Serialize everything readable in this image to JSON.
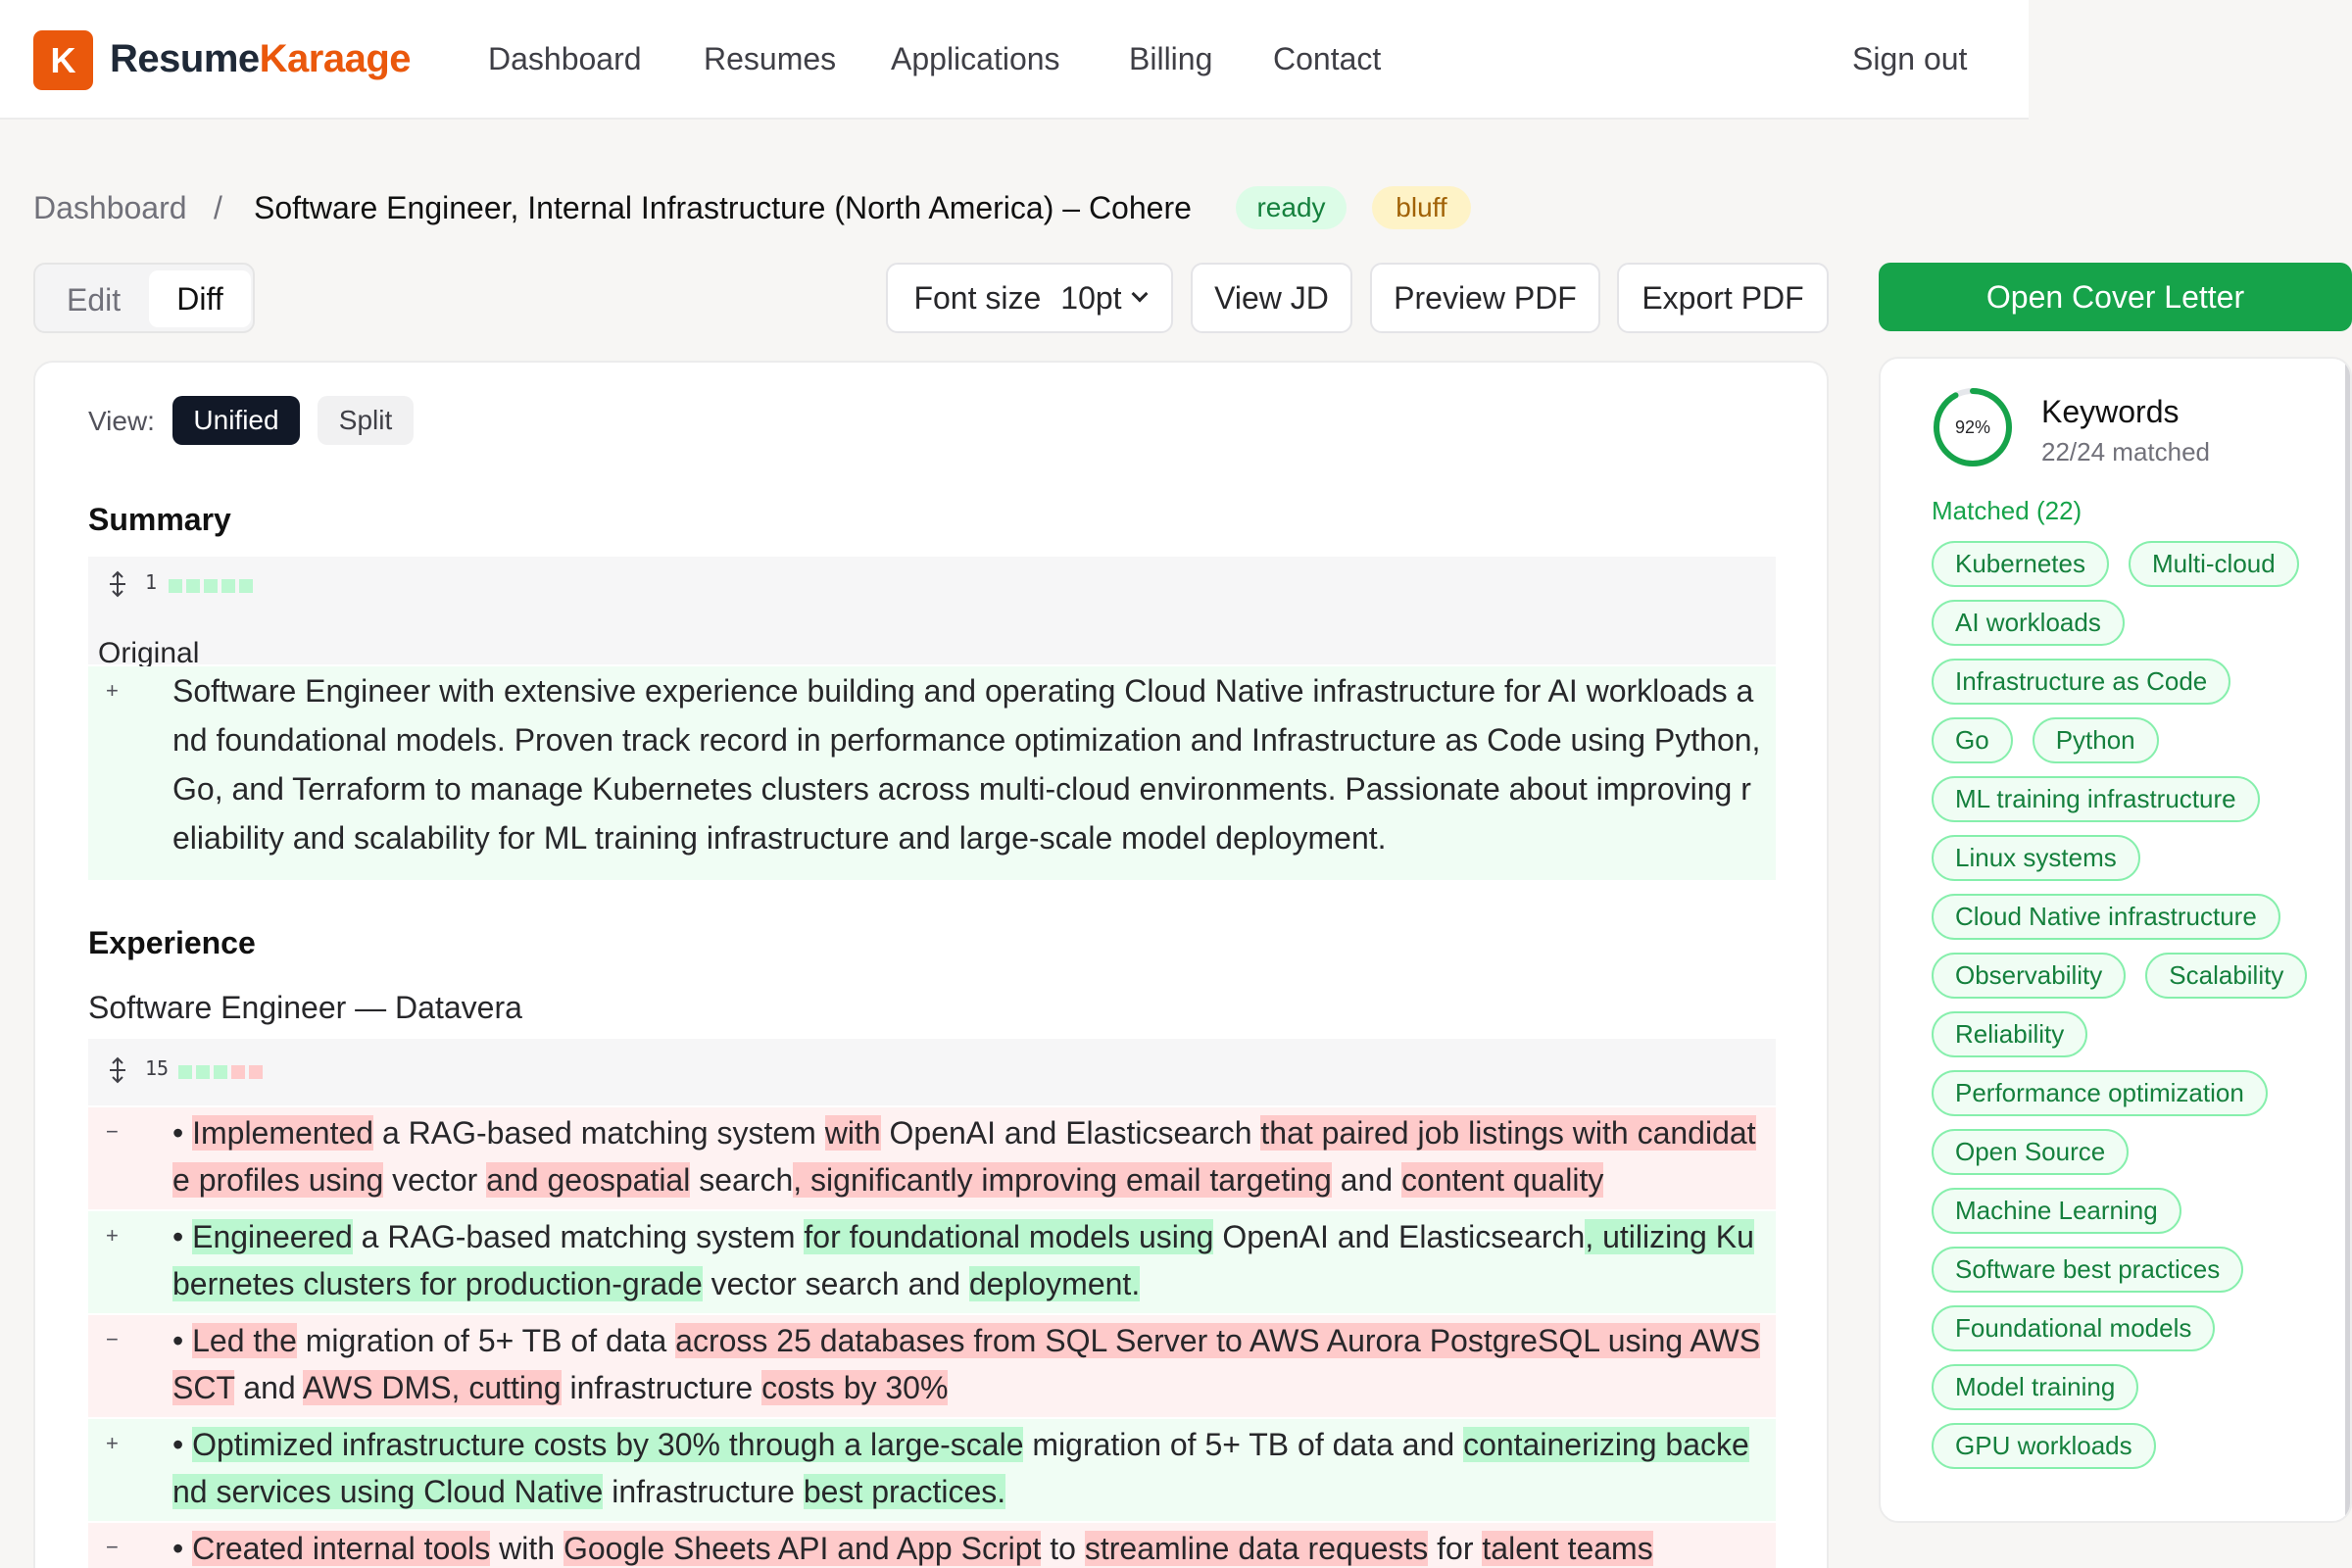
{
  "brand": {
    "logo_letter": "K",
    "name_part1": "Resume",
    "name_part2": "Karaage",
    "accent": "#ea580c"
  },
  "nav": {
    "items": [
      "Dashboard",
      "Resumes",
      "Applications",
      "Billing",
      "Contact"
    ],
    "signout": "Sign out"
  },
  "breadcrumb": {
    "home": "Dashboard",
    "sep": "/",
    "title": "Software Engineer, Internal Infrastructure (North America) – Cohere"
  },
  "badges": {
    "ready": "ready",
    "bluff": "bluff"
  },
  "toolbar": {
    "edit": "Edit",
    "diff": "Diff",
    "font_size_label": "Font size",
    "font_size_value": "10pt",
    "view_jd": "View JD",
    "preview_pdf": "Preview PDF",
    "export_pdf": "Export PDF",
    "open_cover_letter": "Open Cover Letter"
  },
  "view": {
    "label": "View:",
    "unified": "Unified",
    "split": "Split"
  },
  "summary": {
    "title": "Summary",
    "hunk_count": "1",
    "hunk_squares": [
      "add",
      "add",
      "add",
      "add",
      "add"
    ],
    "original_label": "Original",
    "added_text": "Software Engineer with extensive experience building and operating Cloud Native infrastructure for AI workloads and foundational models. Proven track record in performance optimization and Infrastructure as Code using Python, Go, and Terraform to manage Kubernetes clusters across multi-cloud environments. Passionate about improving reliability and scalability for ML training infrastructure and large-scale model deployment."
  },
  "experience": {
    "title": "Experience",
    "job": "Software Engineer — Datavera",
    "hunk_count": "15",
    "hunk_squares": [
      "add",
      "add",
      "add",
      "del",
      "del"
    ],
    "lines": [
      {
        "type": "del",
        "sign": "−",
        "segments": [
          {
            "t": "• ",
            "h": false
          },
          {
            "t": "Implemented",
            "h": true
          },
          {
            "t": " a RAG-based matching system ",
            "h": false
          },
          {
            "t": "with",
            "h": true
          },
          {
            "t": " OpenAI and Elasticsearch ",
            "h": false
          },
          {
            "t": "that paired job listings with candidate profiles using",
            "h": true
          },
          {
            "t": " vector ",
            "h": false
          },
          {
            "t": "and geospatial",
            "h": true
          },
          {
            "t": " search",
            "h": false
          },
          {
            "t": ", significantly improving email targeting",
            "h": true
          },
          {
            "t": " and ",
            "h": false
          },
          {
            "t": "content quality",
            "h": true
          }
        ]
      },
      {
        "type": "add",
        "sign": "+",
        "segments": [
          {
            "t": "• ",
            "h": false
          },
          {
            "t": "Engineered",
            "h": true
          },
          {
            "t": " a RAG-based matching system ",
            "h": false
          },
          {
            "t": "for foundational models using",
            "h": true
          },
          {
            "t": " OpenAI and Elasticsearch",
            "h": false
          },
          {
            "t": ", utilizing Kubernetes clusters for production-grade",
            "h": true
          },
          {
            "t": " vector search and ",
            "h": false
          },
          {
            "t": "deployment.",
            "h": true
          }
        ]
      },
      {
        "type": "del",
        "sign": "−",
        "segments": [
          {
            "t": "• ",
            "h": false
          },
          {
            "t": "Led the",
            "h": true
          },
          {
            "t": " migration of 5+ TB of data ",
            "h": false
          },
          {
            "t": "across 25 databases from SQL Server to AWS Aurora PostgreSQL using AWS SCT",
            "h": true
          },
          {
            "t": " and ",
            "h": false
          },
          {
            "t": "AWS DMS, cutting",
            "h": true
          },
          {
            "t": " infrastructure ",
            "h": false
          },
          {
            "t": "costs by 30%",
            "h": true
          }
        ]
      },
      {
        "type": "add",
        "sign": "+",
        "segments": [
          {
            "t": "• ",
            "h": false
          },
          {
            "t": "Optimized infrastructure costs by 30% through a large-scale",
            "h": true
          },
          {
            "t": " migration of 5+ TB of data and ",
            "h": false
          },
          {
            "t": "containerizing backend services using Cloud Native",
            "h": true
          },
          {
            "t": " infrastructure ",
            "h": false
          },
          {
            "t": "best practices.",
            "h": true
          }
        ]
      },
      {
        "type": "del",
        "sign": "−",
        "segments": [
          {
            "t": "• ",
            "h": false
          },
          {
            "t": "Created internal tools",
            "h": true
          },
          {
            "t": " with ",
            "h": false
          },
          {
            "t": "Google Sheets API and App Script",
            "h": true
          },
          {
            "t": " to ",
            "h": false
          },
          {
            "t": "streamline data requests",
            "h": true
          },
          {
            "t": " for ",
            "h": false
          },
          {
            "t": "talent teams",
            "h": true
          }
        ]
      }
    ]
  },
  "keywords": {
    "percent": 92,
    "percent_label": "92%",
    "title": "Keywords",
    "subtitle": "22/24 matched",
    "matched_label": "Matched (22)",
    "matched": [
      "Kubernetes",
      "Multi-cloud",
      "AI workloads",
      "Infrastructure as Code",
      "Go",
      "Python",
      "ML training infrastructure",
      "Linux systems",
      "Cloud Native infrastructure",
      "Observability",
      "Scalability",
      "Reliability",
      "Performance optimization",
      "Open Source",
      "Machine Learning",
      "Software best practices",
      "Foundational models",
      "Model training",
      "GPU workloads"
    ]
  },
  "colors": {
    "add_bg": "#f0fdf4",
    "add_mark": "#bbf7d0",
    "del_bg": "#fef2f2",
    "del_mark": "#fecaca",
    "green": "#16a34a"
  }
}
